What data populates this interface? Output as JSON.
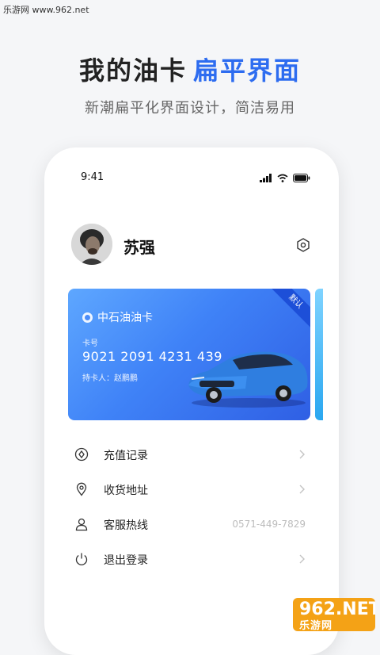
{
  "watermark": "乐游网 www.962.net",
  "promo": {
    "title_main": "我的油卡",
    "title_accent": "扁平界面",
    "subtitle": "新潮扁平化界面设计，简洁易用"
  },
  "status_bar": {
    "time": "9:41"
  },
  "profile": {
    "name": "苏强"
  },
  "card": {
    "brand": "中石油油卡",
    "number_label": "卡号",
    "number": "9021 2091 4231 439",
    "holder": "持卡人：赵鹏鹏",
    "badge": "默认"
  },
  "menu": [
    {
      "label": "充值记录",
      "icon": "diamond-circle-icon",
      "trailing": "chevron"
    },
    {
      "label": "收货地址",
      "icon": "location-pin-icon",
      "trailing": "chevron"
    },
    {
      "label": "客服热线",
      "icon": "user-icon",
      "trailing": "text",
      "value": "0571-449-7829"
    },
    {
      "label": "退出登录",
      "icon": "power-icon",
      "trailing": "chevron"
    }
  ],
  "site_logo": {
    "top": "962.NET",
    "bottom": "乐游网"
  },
  "colors": {
    "accent": "#2d6cf0",
    "card_start": "#5ea7ff",
    "card_end": "#2f5fe4",
    "site_logo": "#f4a216"
  }
}
